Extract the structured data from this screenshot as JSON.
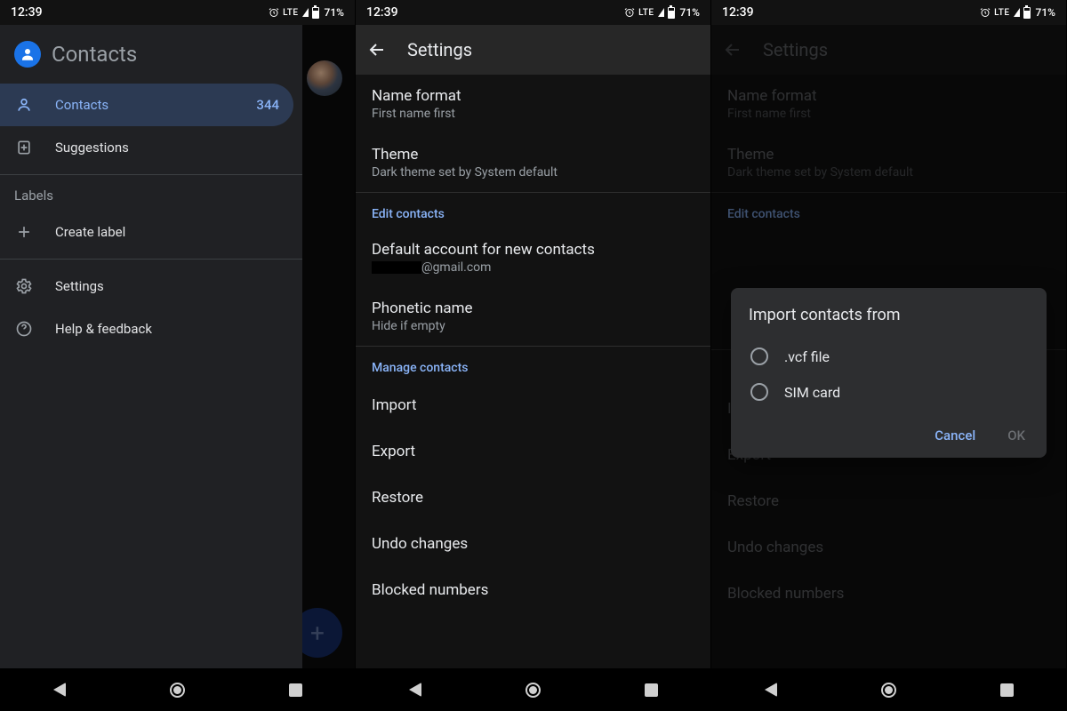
{
  "status": {
    "time": "12:39",
    "lte": "LTE",
    "battery": "71%"
  },
  "panel1": {
    "drawer_title": "Contacts",
    "items": {
      "contacts": {
        "label": "Contacts",
        "count": "344"
      },
      "suggestions": {
        "label": "Suggestions"
      },
      "labels_header": "Labels",
      "create_label": {
        "label": "Create label"
      },
      "settings": {
        "label": "Settings"
      },
      "help": {
        "label": "Help & feedback"
      }
    }
  },
  "settings": {
    "title": "Settings",
    "name_format": {
      "primary": "Name format",
      "secondary": "First name first"
    },
    "theme": {
      "primary": "Theme",
      "secondary": "Dark theme set by System default"
    },
    "edit_header": "Edit contacts",
    "default_account": {
      "primary": "Default account for new contacts",
      "secondary_email": "@gmail.com"
    },
    "phonetic": {
      "primary": "Phonetic name",
      "secondary": "Hide if empty"
    },
    "manage_header": "Manage contacts",
    "import": "Import",
    "export": "Export",
    "restore": "Restore",
    "undo": "Undo changes",
    "blocked": "Blocked numbers"
  },
  "dialog": {
    "title": "Import contacts from",
    "options": {
      "vcf": ".vcf file",
      "sim": "SIM card"
    },
    "cancel": "Cancel",
    "ok": "OK"
  }
}
